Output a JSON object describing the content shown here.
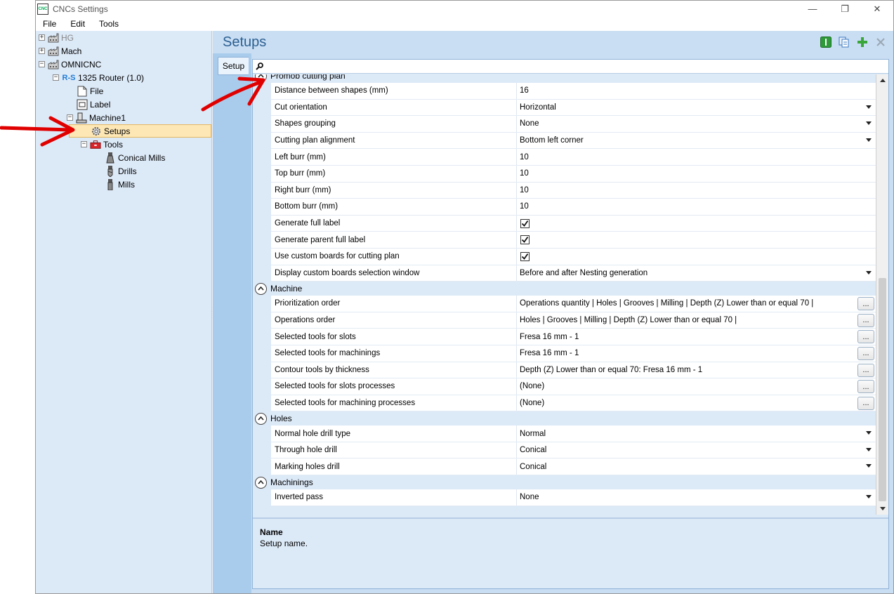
{
  "window": {
    "title": "CNCs Settings",
    "app_icon_text": "CNC",
    "controls": {
      "minimize": "—",
      "restore": "❐",
      "close": "✕"
    }
  },
  "menu": [
    "File",
    "Edit",
    "Tools"
  ],
  "tree": {
    "items": [
      {
        "label": "HG",
        "level": 0,
        "expander": "+",
        "icon": "factory-icon",
        "greyed": true
      },
      {
        "label": "Mach",
        "level": 0,
        "expander": "+",
        "icon": "factory-icon"
      },
      {
        "label": "OMNICNC",
        "level": 0,
        "expander": "−",
        "icon": "factory-icon"
      },
      {
        "label": "1325 Router (1.0)",
        "level": 1,
        "expander": "−",
        "icon": "router-icon",
        "icon_text": "R-S"
      },
      {
        "label": "File",
        "level": 2,
        "icon": "file-icon"
      },
      {
        "label": "Label",
        "level": 2,
        "icon": "label-icon"
      },
      {
        "label": "Machine1",
        "level": 2,
        "expander": "−",
        "icon": "machine-icon"
      },
      {
        "label": "Setups",
        "level": 3,
        "icon": "gear-icon",
        "selected": true
      },
      {
        "label": "Tools",
        "level": 3,
        "expander": "−",
        "icon": "toolbox-icon"
      },
      {
        "label": "Conical Mills",
        "level": 4,
        "icon": "conical-mill-icon"
      },
      {
        "label": "Drills",
        "level": 4,
        "icon": "drill-icon"
      },
      {
        "label": "Mills",
        "level": 4,
        "icon": "mill-icon"
      }
    ]
  },
  "page_title": "Setups",
  "tab_label": "Setup",
  "search": {
    "icon": "search-icon",
    "value": ""
  },
  "categories": [
    {
      "label": "Promob cutting plan",
      "rows": [
        {
          "name": "Distance between shapes (mm)",
          "value": "16",
          "type": "text"
        },
        {
          "name": "Cut orientation",
          "value": "Horizontal",
          "type": "dropdown"
        },
        {
          "name": "Shapes grouping",
          "value": "None",
          "type": "dropdown"
        },
        {
          "name": "Cutting plan alignment",
          "value": "Bottom left corner",
          "type": "dropdown"
        },
        {
          "name": "Left burr (mm)",
          "value": "10",
          "type": "text"
        },
        {
          "name": "Top burr (mm)",
          "value": "10",
          "type": "text"
        },
        {
          "name": "Right burr (mm)",
          "value": "10",
          "type": "text"
        },
        {
          "name": "Bottom burr (mm)",
          "value": "10",
          "type": "text"
        },
        {
          "name": "Generate full label",
          "value": "",
          "type": "checkbox",
          "checked": true
        },
        {
          "name": "Generate parent full label",
          "value": "",
          "type": "checkbox",
          "checked": true
        },
        {
          "name": "Use custom boards for cutting plan",
          "value": "",
          "type": "checkbox",
          "checked": true
        },
        {
          "name": "Display custom boards selection window",
          "value": "Before and after Nesting generation",
          "type": "dropdown"
        }
      ]
    },
    {
      "label": "Machine",
      "rows": [
        {
          "name": "Prioritization order",
          "value": "Operations quantity | Holes | Grooves | Milling | Depth (Z) Lower than or equal 70 |",
          "type": "ellipsis"
        },
        {
          "name": "Operations order",
          "value": "Holes | Grooves | Milling | Depth (Z) Lower than or equal 70 |",
          "type": "ellipsis"
        },
        {
          "name": "Selected tools for slots",
          "value": "Fresa 16 mm - 1",
          "type": "ellipsis"
        },
        {
          "name": "Selected tools for machinings",
          "value": "Fresa 16 mm - 1",
          "type": "ellipsis"
        },
        {
          "name": "Contour tools by thickness",
          "value": "Depth (Z) Lower than or equal 70: Fresa 16 mm - 1",
          "type": "ellipsis"
        },
        {
          "name": "Selected tools for slots processes",
          "value": "(None)",
          "type": "ellipsis"
        },
        {
          "name": "Selected tools for machining processes",
          "value": "(None)",
          "type": "ellipsis"
        }
      ]
    },
    {
      "label": "Holes",
      "rows": [
        {
          "name": "Normal hole drill type",
          "value": "Normal",
          "type": "dropdown"
        },
        {
          "name": "Through hole drill",
          "value": "Conical",
          "type": "dropdown"
        },
        {
          "name": "Marking holes drill",
          "value": "Conical",
          "type": "dropdown"
        }
      ]
    },
    {
      "label": "Machinings",
      "rows": [
        {
          "name": "Inverted pass",
          "value": "None",
          "type": "dropdown"
        }
      ]
    }
  ],
  "ellipsis_label": "...",
  "description": {
    "title": "Name",
    "text": "Setup name."
  },
  "colors": {
    "accent": "#2b5f91",
    "selected_bg": "#fde7b5",
    "annotation_arrow": "#e00000",
    "pane_bg": "#dce9f7"
  }
}
